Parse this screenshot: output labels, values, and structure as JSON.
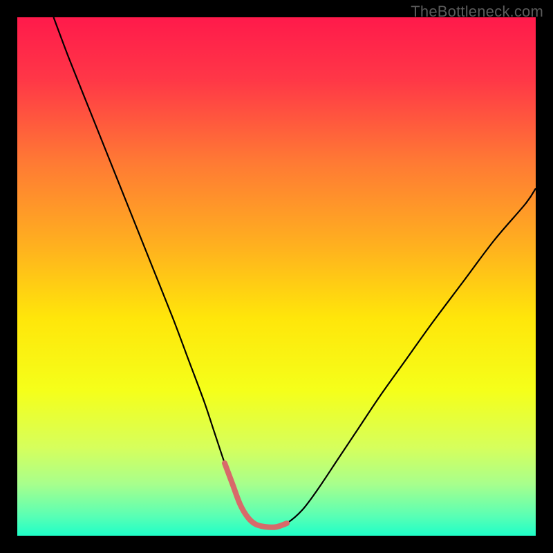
{
  "watermark": "TheBottleneck.com",
  "chart_data": {
    "type": "line",
    "title": "",
    "xlabel": "",
    "ylabel": "",
    "xlim": [
      0,
      100
    ],
    "ylim": [
      0,
      100
    ],
    "grid": false,
    "legend": false,
    "background_gradient": {
      "stops": [
        {
          "offset": 0.0,
          "color": "#ff1a4b"
        },
        {
          "offset": 0.12,
          "color": "#ff3747"
        },
        {
          "offset": 0.28,
          "color": "#ff7a34"
        },
        {
          "offset": 0.44,
          "color": "#ffb01f"
        },
        {
          "offset": 0.58,
          "color": "#ffe60a"
        },
        {
          "offset": 0.72,
          "color": "#f5ff1a"
        },
        {
          "offset": 0.83,
          "color": "#d6ff5c"
        },
        {
          "offset": 0.9,
          "color": "#a8ff8c"
        },
        {
          "offset": 0.96,
          "color": "#5cffb3"
        },
        {
          "offset": 1.0,
          "color": "#1fffc8"
        }
      ]
    },
    "series": [
      {
        "name": "bottleneck-curve",
        "stroke": "#000000",
        "stroke_width": 2.2,
        "x": [
          7,
          10,
          14,
          18,
          22,
          26,
          30,
          33,
          36,
          38,
          40,
          41.5,
          43,
          44.5,
          46,
          48,
          50,
          52,
          55,
          58,
          62,
          66,
          70,
          75,
          80,
          86,
          92,
          98,
          100
        ],
        "y": [
          100,
          92,
          82,
          72,
          62,
          52,
          42,
          34,
          26,
          20,
          14,
          10,
          6,
          3.5,
          2.2,
          1.7,
          1.7,
          2.4,
          5,
          9,
          15,
          21,
          27,
          34,
          41,
          49,
          57,
          64,
          67
        ]
      },
      {
        "name": "highlight-trough",
        "stroke": "#d86a6a",
        "stroke_width": 8,
        "linecap": "round",
        "x": [
          40,
          41.5,
          43,
          44.5,
          46,
          48,
          50,
          52
        ],
        "y": [
          14,
          10,
          6,
          3.5,
          2.2,
          1.7,
          1.7,
          2.4
        ]
      }
    ]
  }
}
